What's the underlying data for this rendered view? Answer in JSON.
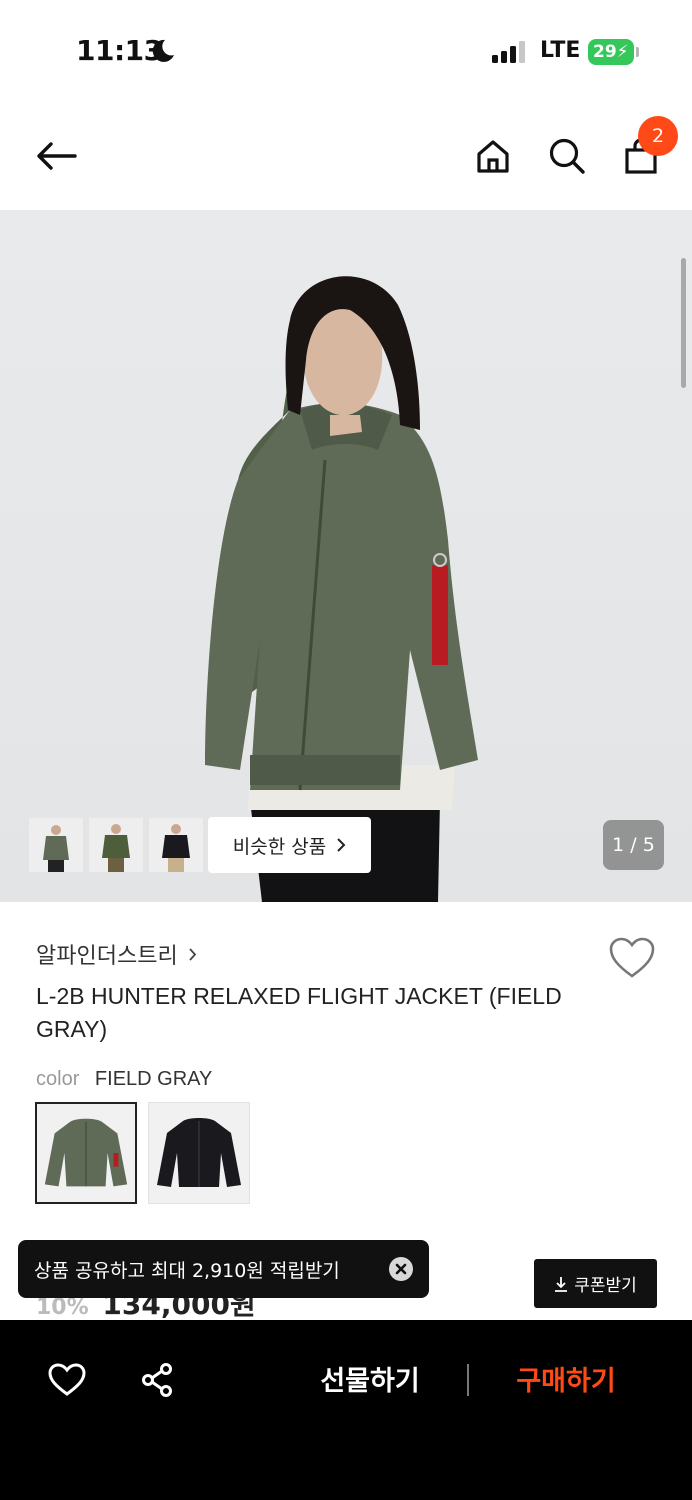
{
  "status_bar": {
    "time": "11:13",
    "network": "LTE",
    "battery": "29"
  },
  "header": {
    "cart_count": "2"
  },
  "gallery": {
    "similar_label": "비슷한 상품",
    "pager": "1 / 5"
  },
  "product": {
    "brand": "알파인더스트리",
    "title": "L-2B HUNTER RELAXED FLIGHT JACKET (FIELD GRAY)",
    "color_label": "color",
    "color_value": "FIELD GRAY",
    "swatches": [
      {
        "name": "FIELD GRAY",
        "hex": "#5f6b57"
      },
      {
        "name": "BLACK",
        "hex": "#1a1a1e"
      }
    ],
    "discount": "10%",
    "price": "134,000원"
  },
  "toast": {
    "message": "상품 공유하고 최대 2,910원 적립받기"
  },
  "coupon": {
    "label": "쿠폰받기"
  },
  "bottom_bar": {
    "gift_label": "선물하기",
    "buy_label": "구매하기"
  },
  "colors": {
    "accent": "#ff4a17",
    "battery": "#34c759",
    "jacket": "#5f6b57"
  }
}
